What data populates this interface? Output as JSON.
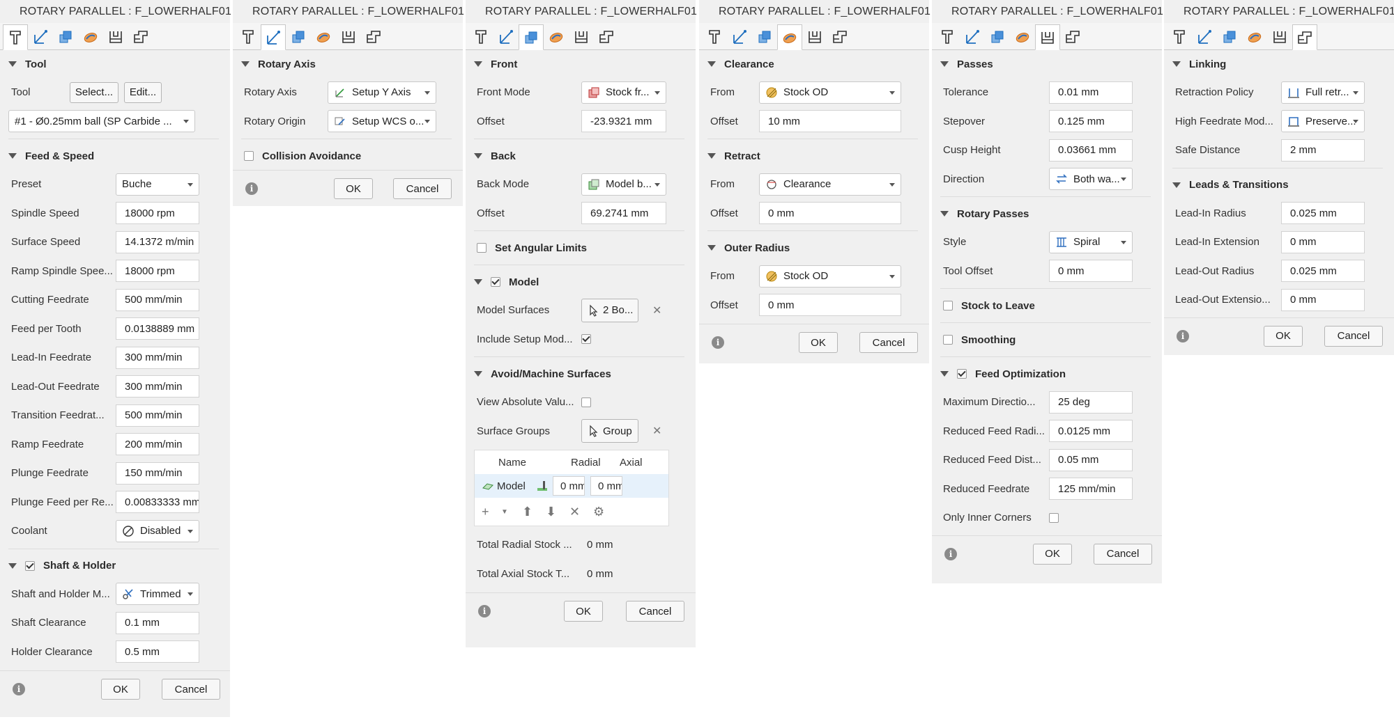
{
  "window_title": "ROTARY PARALLEL : F_LOWERHALF01",
  "ok": "OK",
  "cancel": "Cancel",
  "tab_icons": [
    "tool-tab-icon",
    "geometry-tab-icon",
    "heights-tab-icon",
    "passes-tab-icon",
    "linking-tab-icon",
    "post-tab-icon"
  ],
  "panel1": {
    "tool": {
      "title": "Tool",
      "label": "Tool",
      "select": "Select...",
      "edit": "Edit...",
      "tool_value": "#1 - Ø0.25mm ball (SP Carbide ..."
    },
    "feed": {
      "title": "Feed & Speed",
      "rows": [
        {
          "label": "Preset",
          "value": "Buche",
          "kind": "select"
        },
        {
          "label": "Spindle Speed",
          "value": "18000 rpm"
        },
        {
          "label": "Surface Speed",
          "value": "14.1372 m/min"
        },
        {
          "label": "Ramp Spindle Speed",
          "display_label": "Ramp Spindle Spee...",
          "value": "18000 rpm"
        },
        {
          "label": "Cutting Feedrate",
          "value": "500 mm/min"
        },
        {
          "label": "Feed per Tooth",
          "value": "0.0138889 mm"
        },
        {
          "label": "Lead-In Feedrate",
          "value": "300 mm/min"
        },
        {
          "label": "Lead-Out Feedrate",
          "value": "300 mm/min"
        },
        {
          "label": "Transition Feedrate",
          "display_label": "Transition Feedrat...",
          "value": "500 mm/min"
        },
        {
          "label": "Ramp Feedrate",
          "value": "200 mm/min"
        },
        {
          "label": "Plunge Feedrate",
          "value": "150 mm/min"
        },
        {
          "label": "Plunge Feed per Rev",
          "display_label": "Plunge Feed per Re...",
          "value": "0.00833333 mm"
        },
        {
          "label": "Coolant",
          "value": "Disabled",
          "kind": "select"
        }
      ]
    },
    "shaft": {
      "title": "Shaft & Holder",
      "mode_label": "Shaft and Holder M...",
      "mode_value": "Trimmed",
      "shaft_clearance_label": "Shaft Clearance",
      "shaft_clearance": "0.1 mm",
      "holder_clearance_label": "Holder Clearance",
      "holder_clearance": "0.5 mm"
    }
  },
  "panel2": {
    "title": "Rotary Axis",
    "axis_label": "Rotary Axis",
    "axis_value": "Setup Y Axis",
    "origin_label": "Rotary Origin",
    "origin_value": "Setup WCS o...",
    "collision": "Collision Avoidance"
  },
  "panel3": {
    "front": {
      "title": "Front",
      "mode_label": "Front Mode",
      "mode_value": "Stock fr...",
      "offset_label": "Offset",
      "offset": "-23.9321 mm"
    },
    "back": {
      "title": "Back",
      "mode_label": "Back Mode",
      "mode_value": "Model b...",
      "offset_label": "Offset",
      "offset": "69.2741 mm"
    },
    "angular": "Set Angular Limits",
    "model": {
      "title": "Model",
      "surfaces_label": "Model Surfaces",
      "surfaces_value": "2 Bo...",
      "include_label": "Include Setup Mod..."
    },
    "avoid": {
      "title": "Avoid/Machine Surfaces",
      "view_abs_label": "View Absolute Valu...",
      "groups_label": "Surface Groups",
      "groups_value": "Group",
      "table_headers": [
        "Name",
        "Radial",
        "Axial"
      ],
      "table_row": {
        "name": "Model",
        "radial": "0 mm",
        "axial": "0 mm"
      }
    },
    "total_radial_label": "Total Radial Stock ...",
    "total_radial": "0 mm",
    "total_axial_label": "Total Axial Stock T...",
    "total_axial": "0 mm"
  },
  "panel4": {
    "clearance": {
      "title": "Clearance",
      "from_label": "From",
      "from_value": "Stock OD",
      "offset_label": "Offset",
      "offset": "10 mm"
    },
    "retract": {
      "title": "Retract",
      "from_label": "From",
      "from_value": "Clearance",
      "offset_label": "Offset",
      "offset": "0 mm"
    },
    "outer": {
      "title": "Outer Radius",
      "from_label": "From",
      "from_value": "Stock OD",
      "offset_label": "Offset",
      "offset": "0 mm"
    }
  },
  "panel5": {
    "passes": {
      "title": "Passes",
      "tolerance_label": "Tolerance",
      "tolerance": "0.01 mm",
      "stepover_label": "Stepover",
      "stepover": "0.125 mm",
      "cusp_label": "Cusp Height",
      "cusp": "0.03661 mm",
      "direction_label": "Direction",
      "direction": "Both wa..."
    },
    "rotary": {
      "title": "Rotary Passes",
      "style_label": "Style",
      "style_value": "Spiral",
      "tool_offset_label": "Tool Offset",
      "tool_offset": "0 mm"
    },
    "stock_to_leave": "Stock to Leave",
    "smoothing": "Smoothing",
    "feedopt": {
      "title": "Feed Optimization",
      "max_dir_label": "Maximum Directio...",
      "max_dir": "25 deg",
      "red_radius_label": "Reduced Feed Radi...",
      "red_radius": "0.0125 mm",
      "red_dist_label": "Reduced Feed Dist...",
      "red_dist": "0.05 mm",
      "red_feed_label": "Reduced Feedrate",
      "red_feed": "125 mm/min",
      "inner_label": "Only Inner Corners"
    }
  },
  "panel6": {
    "linking": {
      "title": "Linking",
      "retraction_label": "Retraction Policy",
      "retraction_value": "Full retr...",
      "hf_label": "High Feedrate Mod...",
      "hf_value": "Preserve...",
      "safe_label": "Safe Distance",
      "safe": "2 mm"
    },
    "leads": {
      "title": "Leads & Transitions",
      "in_radius_label": "Lead-In Radius",
      "in_radius": "0.025 mm",
      "in_ext_label": "Lead-In Extension",
      "in_ext": "0 mm",
      "out_radius_label": "Lead-Out Radius",
      "out_radius": "0.025 mm",
      "out_ext_label": "Lead-Out Extensio...",
      "out_ext": "0 mm"
    }
  }
}
